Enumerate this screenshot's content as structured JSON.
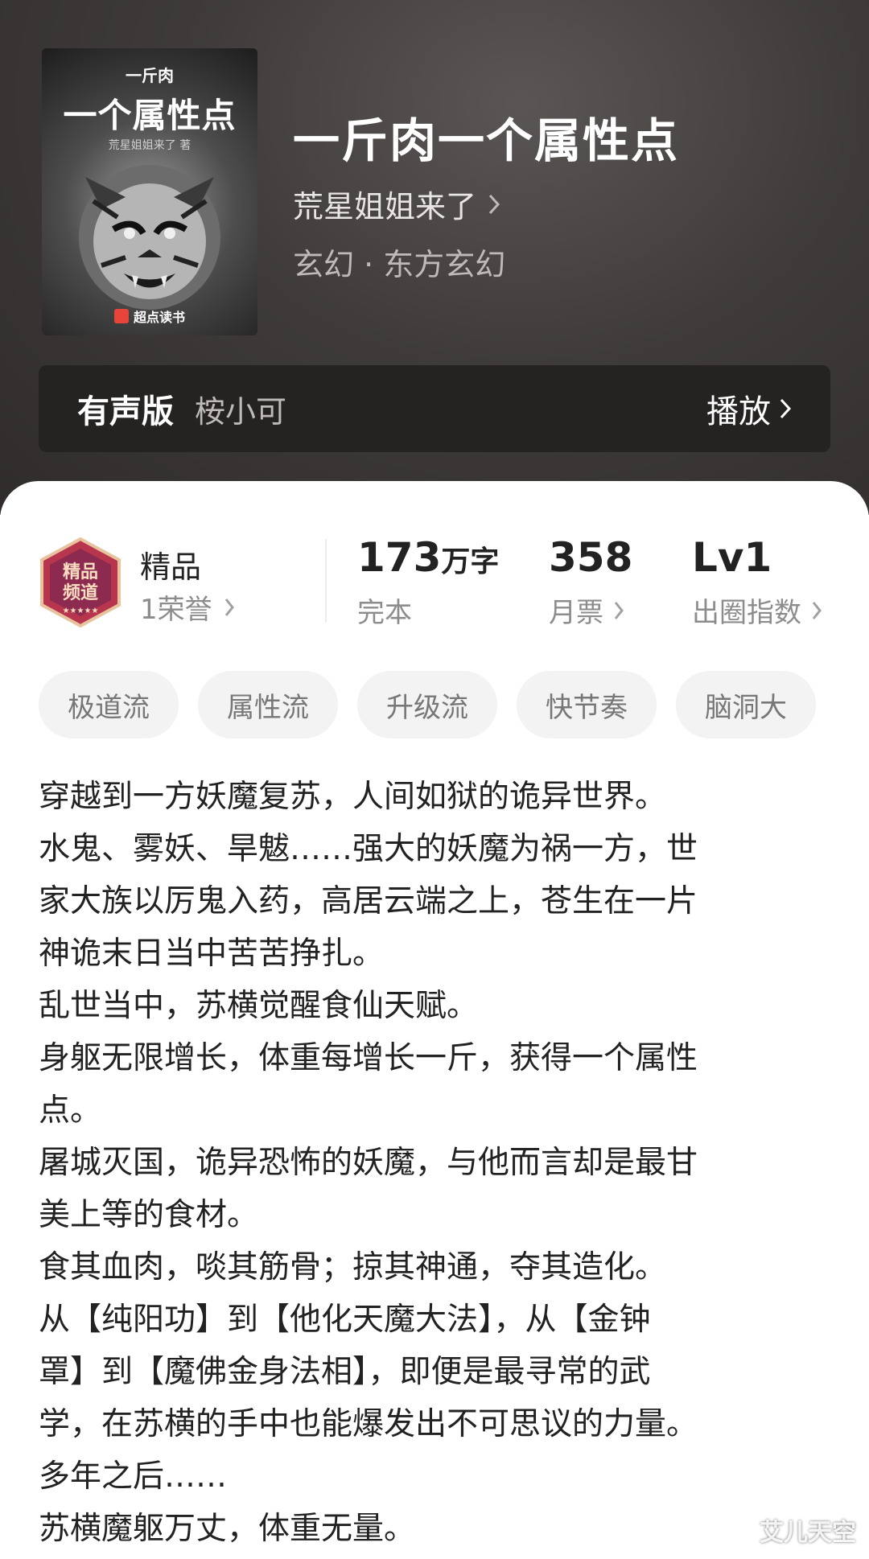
{
  "book": {
    "cover": {
      "author": "一斤肉",
      "title": "一个属性点",
      "subtitle": "荒星姐姐来了 著",
      "brand": "超点读书"
    },
    "title": "一斤肉一个属性点",
    "author": "荒星姐姐来了",
    "genre": "玄幻 · 东方玄幻"
  },
  "audio": {
    "label": "有声版",
    "narrator": "桉小可",
    "play_label": "播放"
  },
  "stats": {
    "honor_title": "精品",
    "honor_sub": "1荣誉",
    "words_num": "173",
    "words_unit": "万字",
    "words_label": "完本",
    "tickets_num": "358",
    "tickets_label": "月票",
    "level_num": "Lv1",
    "level_label": "出圈指数"
  },
  "tags": [
    "极道流",
    "属性流",
    "升级流",
    "快节奏",
    "脑洞大"
  ],
  "synopsis": [
    "穿越到一方妖魔复苏，人间如狱的诡异世界。",
    "水鬼、雾妖、旱魃……强大的妖魔为祸一方，世",
    "家大族以厉鬼入药，高居云端之上，苍生在一片",
    "神诡末日当中苦苦挣扎。",
    "乱世当中，苏横觉醒食仙天赋。",
    "身躯无限增长，体重每增长一斤，获得一个属性",
    "点。",
    "屠城灭国，诡异恐怖的妖魔，与他而言却是最甘",
    "美上等的食材。",
    "食其血肉，啖其筋骨；掠其神通，夺其造化。",
    "从【纯阳功】到【他化天魔大法】，从【金钟",
    "罩】到【魔佛金身法相】，即便是最寻常的武",
    "学，在苏横的手中也能爆发出不可思议的力量。",
    "多年之后……",
    "苏横魔躯万丈，体重无量。"
  ],
  "watermark": "艾儿天空",
  "colors": {
    "header_bg": "#3e3b3a",
    "audio_bar": "#252322",
    "tag_bg": "#f3f3f3",
    "badge_red": "#b8364d"
  },
  "icons": [
    "chevron-right-icon",
    "honor-badge-icon",
    "tiger-cover-art"
  ]
}
